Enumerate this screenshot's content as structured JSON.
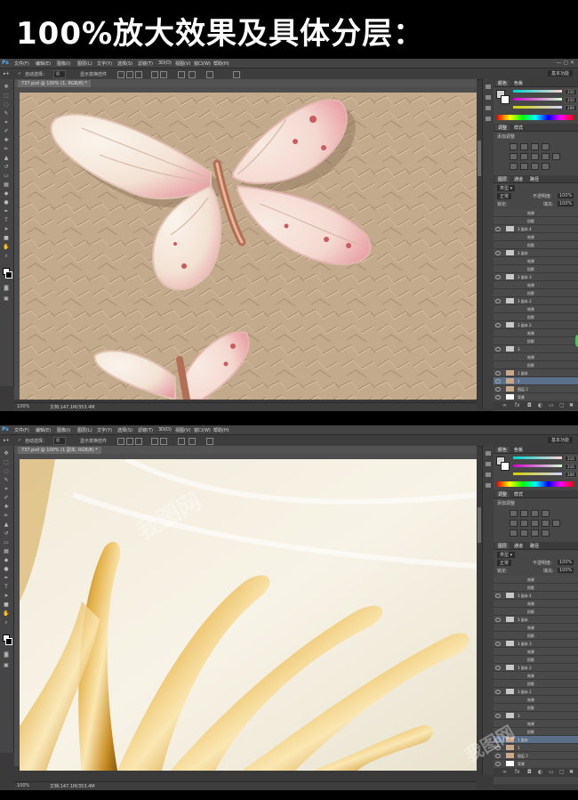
{
  "heading": "100%放大效果及具体分层：",
  "ps": {
    "logo": "Ps",
    "menus": [
      "文件(F)",
      "编辑(E)",
      "图像(I)",
      "图层(L)",
      "文字(Y)",
      "选择(S)",
      "滤镜(T)",
      "3D(D)",
      "视图(V)",
      "窗口(W)",
      "帮助(H)"
    ],
    "options": {
      "auto_select": "自动选择：",
      "auto_select_value": "组",
      "show_transform": "显示变换控件"
    },
    "doc_tab_1": "737.psd @ 100% (1, RGB/8) *",
    "doc_tab_2": "737.psd @ 100% (1 副本, RGB/8) *",
    "zoom": "100%",
    "doc_size": "文档:147.1M/353.4M",
    "panel_tabs": {
      "color": "颜色",
      "swatches": "色板",
      "adjust": "调整",
      "styles": "样式",
      "add_adjust": "添加调整",
      "layers": "图层",
      "channels": "通道",
      "paths": "路径"
    },
    "color_values": [
      "210",
      "210",
      "209"
    ],
    "blend_mode": "正常",
    "opacity_label": "不透明度:",
    "opacity": "100%",
    "lock_label": "锁定:",
    "fill_label": "填充:",
    "fill": "100%",
    "layers": [
      "效果",
      "投影",
      "3 副本 4",
      "效果",
      "投影",
      "3 副本",
      "效果",
      "投影",
      "3 副本 3",
      "效果",
      "投影",
      "3 副本 2",
      "效果",
      "投影",
      "3 副本 2",
      "效果",
      "投影",
      "3",
      "效果",
      "投影",
      "1 副本",
      "1",
      "图层 2",
      "背景"
    ],
    "watermark": "我图网"
  }
}
